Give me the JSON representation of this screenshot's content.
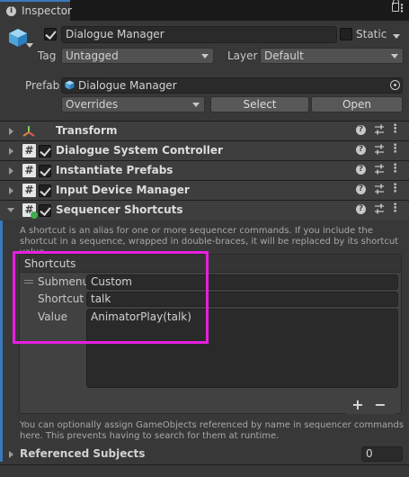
{
  "tab": {
    "title": "Inspector"
  },
  "header": {
    "object_name": "Dialogue Manager",
    "static_label": "Static",
    "tag_label": "Tag",
    "tag_value": "Untagged",
    "layer_label": "Layer",
    "layer_value": "Default",
    "prefab_label": "Prefab",
    "prefab_value": "Dialogue Manager",
    "overrides_label": "Overrides",
    "select_label": "Select",
    "open_label": "Open"
  },
  "components": [
    {
      "name": "Transform"
    },
    {
      "name": "Dialogue System Controller"
    },
    {
      "name": "Instantiate Prefabs"
    },
    {
      "name": "Input Device Manager"
    },
    {
      "name": "Sequencer Shortcuts"
    }
  ],
  "sequencer": {
    "description": "A shortcut is an alias for one or more sequencer commands. If you include the shortcut in a sequence, wrapped in double-braces, it will be replaced by its shortcut value.",
    "shortcuts_header": "Shortcuts",
    "submenu_label": "Submenu",
    "submenu_value": "Custom",
    "shortcut_label": "Shortcut",
    "shortcut_value": "talk",
    "value_label": "Value",
    "value_value": "AnimatorPlay(talk)",
    "add_label": "+",
    "remove_label": "−",
    "footer_info": "You can optionally assign GameObjects referenced by name in sequencer commands here. This prevents having to search for them at runtime.",
    "referenced_subjects_label": "Referenced Subjects",
    "referenced_subjects_count": "0"
  },
  "colors": {
    "highlight": "#e81ee0",
    "accent": "#3a79bb"
  }
}
